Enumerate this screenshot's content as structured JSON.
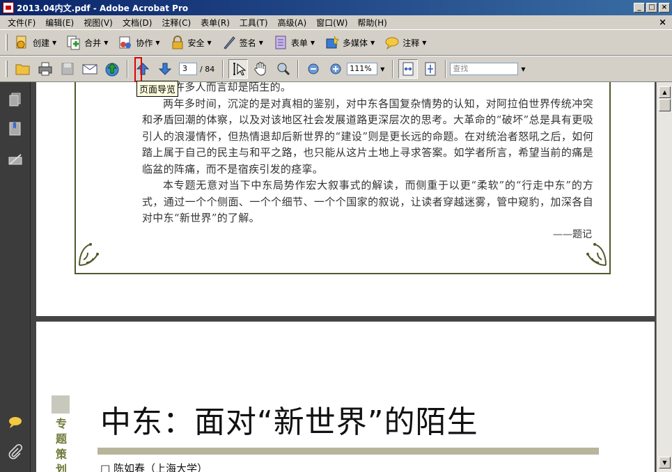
{
  "window": {
    "title": "2013.04内文.pdf - Adobe Acrobat Pro",
    "minimize": "_",
    "maximize": "□",
    "close": "×"
  },
  "menu": {
    "items": [
      "文件(F)",
      "编辑(E)",
      "视图(V)",
      "文档(D)",
      "注释(C)",
      "表单(R)",
      "工具(T)",
      "高级(A)",
      "窗口(W)",
      "帮助(H)"
    ],
    "doc_close": "×"
  },
  "tasks": [
    {
      "label": "创建",
      "icon": "create-pdf-icon"
    },
    {
      "label": "合并",
      "icon": "combine-icon"
    },
    {
      "label": "协作",
      "icon": "collaborate-icon"
    },
    {
      "label": "安全",
      "icon": "lock-icon"
    },
    {
      "label": "签名",
      "icon": "pen-icon"
    },
    {
      "label": "表单",
      "icon": "form-icon"
    },
    {
      "label": "多媒体",
      "icon": "multimedia-icon"
    },
    {
      "label": "注释",
      "icon": "comment-cloud-icon"
    }
  ],
  "navigation": {
    "current_page": "3",
    "total_pages": "/ 84",
    "zoom": "111%",
    "search_placeholder": "查找"
  },
  "tooltip": "页面导览",
  "document": {
    "first_line": "面貌对许多人而言却是陌生的。",
    "paragraphs": [
      "两年多时间，沉淀的是对真相的鉴别，对中东各国复杂情势的认知，对阿拉伯世界传统冲突和矛盾回潮的体察，以及对该地区社会发展道路更深层次的思考。大革命的“破坏”总是具有更吸引人的浪漫情怀，但热情退却后新世界的“建设”则是更长远的命题。在对统治者怒吼之后，如何踏上属于自己的民主与和平之路，也只能从这片土地上寻求答案。如学者所言，希望当前的痛是临盆的阵痛，而不是宿疾引发的痉挛。",
      "本专题无意对当下中东局势作宏大叙事式的解读，而侧重于以更“柔软”的“行走中东”的方式，通过一个个侧面、一个个细节、一个个国家的叙说，让读者穿越迷雾，管中窥豹，加深各自对中东“新世界”的了解。"
    ],
    "signature": "——题记",
    "strip_text": "专题策划",
    "headline": "中东：面对“新世界”的陌生",
    "byline": "□ 陈如春（上海大学）"
  },
  "colors": {
    "frame": "#4f5a2a",
    "accent_green": "#6f7a3a",
    "headline_bar": "#b7b59c",
    "tooltip_bg": "#ffffe1",
    "marker": "#e00000"
  }
}
